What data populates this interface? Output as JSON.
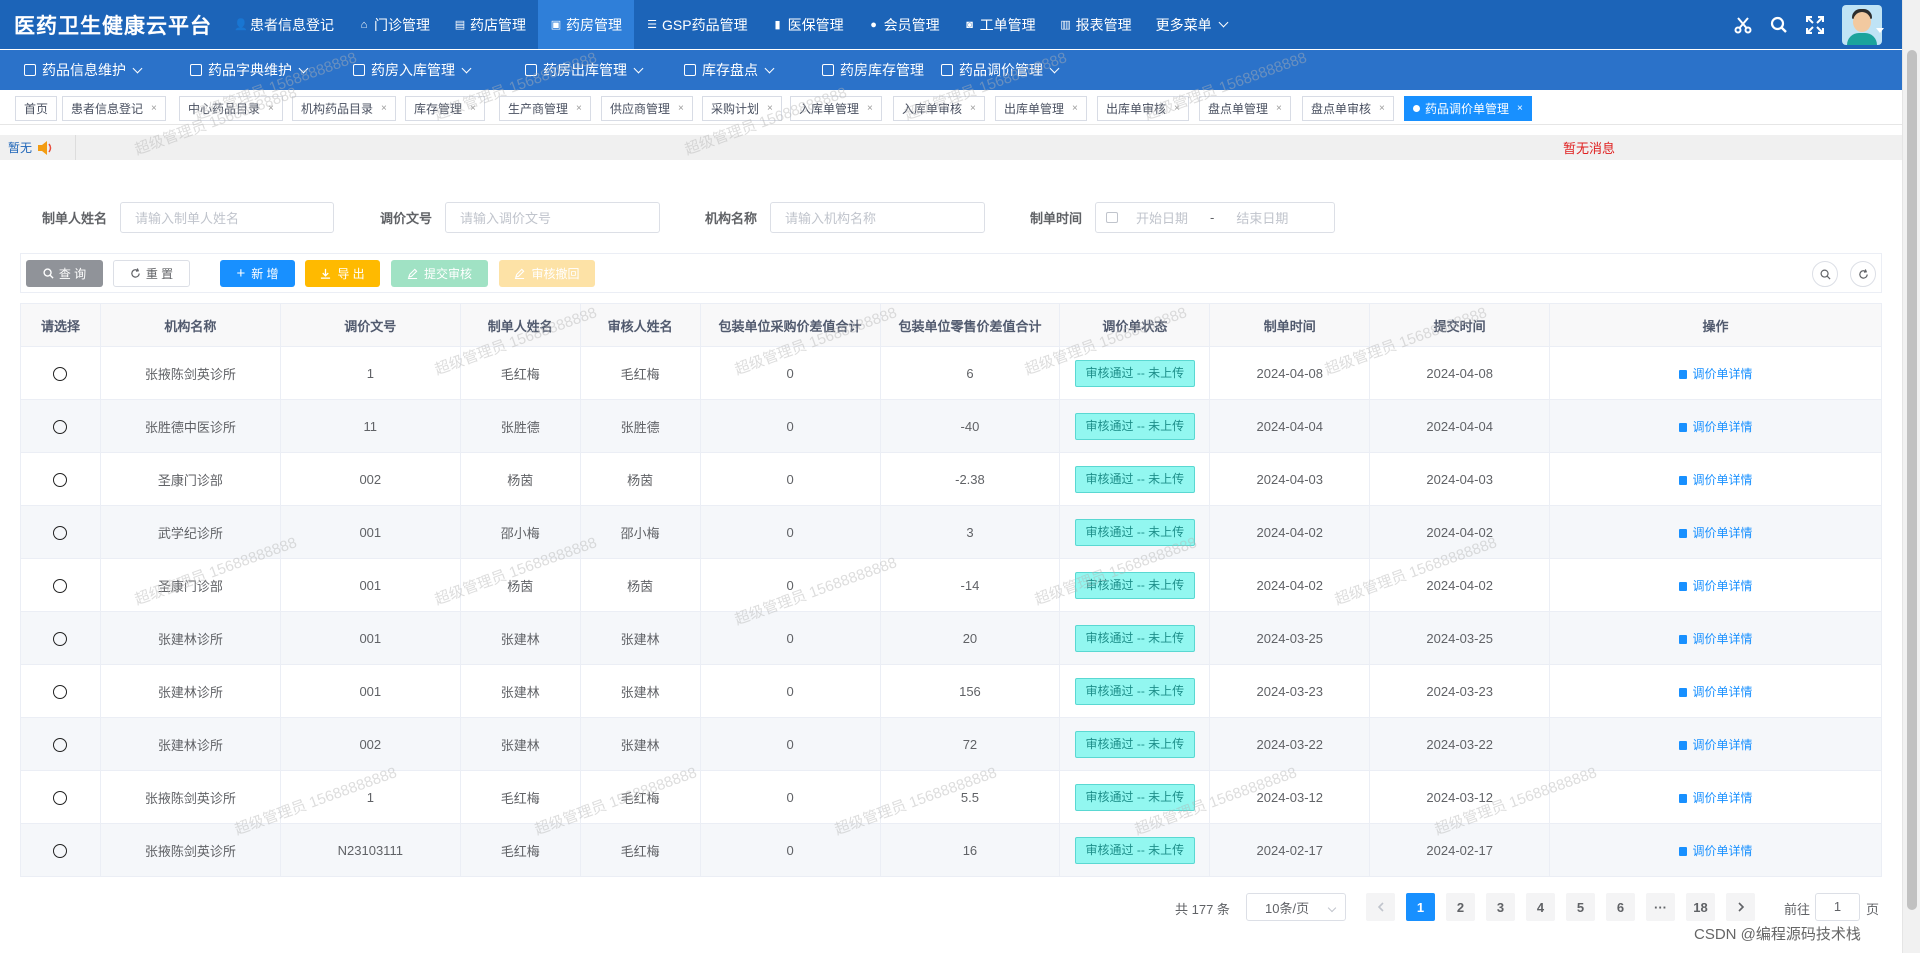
{
  "brand": "医药卫生健康云平台",
  "topnav": [
    {
      "label": "患者信息登记",
      "icon": "user-icon",
      "active": false
    },
    {
      "label": "门诊管理",
      "icon": "clinic-icon",
      "active": false
    },
    {
      "label": "药店管理",
      "icon": "store-icon",
      "active": false
    },
    {
      "label": "药房管理",
      "icon": "pharmacy-icon",
      "active": true
    },
    {
      "label": "GSP药品管理",
      "icon": "list-icon",
      "active": false
    },
    {
      "label": "医保管理",
      "icon": "book-icon",
      "active": false
    },
    {
      "label": "会员管理",
      "icon": "github-icon",
      "active": false
    },
    {
      "label": "工单管理",
      "icon": "ticket-icon",
      "active": false
    },
    {
      "label": "报表管理",
      "icon": "chart-icon",
      "active": false
    },
    {
      "label": "更多菜单",
      "icon": "",
      "active": false
    }
  ],
  "subnav": [
    "药品信息维护",
    "药品字典维护",
    "药房入库管理",
    "药房出库管理",
    "库存盘点",
    "药房库存管理",
    "药品调价管理"
  ],
  "tabs": [
    {
      "label": "首页",
      "closable": false,
      "active": false
    },
    {
      "label": "患者信息登记",
      "closable": true,
      "active": false
    },
    {
      "label": "中心药品目录",
      "closable": true,
      "active": false
    },
    {
      "label": "机构药品目录",
      "closable": true,
      "active": false
    },
    {
      "label": "库存管理",
      "closable": true,
      "active": false
    },
    {
      "label": "生产商管理",
      "closable": true,
      "active": false
    },
    {
      "label": "供应商管理",
      "closable": true,
      "active": false
    },
    {
      "label": "采购计划",
      "closable": true,
      "active": false
    },
    {
      "label": "入库单管理",
      "closable": true,
      "active": false
    },
    {
      "label": "入库单审核",
      "closable": true,
      "active": false
    },
    {
      "label": "出库单管理",
      "closable": true,
      "active": false
    },
    {
      "label": "出库单审核",
      "closable": true,
      "active": false
    },
    {
      "label": "盘点单管理",
      "closable": true,
      "active": false
    },
    {
      "label": "盘点单审核",
      "closable": true,
      "active": false
    },
    {
      "label": "药品调价单管理",
      "closable": true,
      "active": true
    }
  ],
  "notice": {
    "label": "暂无",
    "message": "暂无消息"
  },
  "filters": {
    "creator_label": "制单人姓名",
    "creator_placeholder": "请输入制单人姓名",
    "docno_label": "调价文号",
    "docno_placeholder": "请输入调价文号",
    "org_label": "机构名称",
    "org_placeholder": "请输入机构名称",
    "date_label": "制单时间",
    "start_placeholder": "开始日期",
    "date_sep": "-",
    "end_placeholder": "结束日期"
  },
  "toolbar": {
    "query": "查 询",
    "reset": "重 置",
    "add": "新 增",
    "export": "导 出",
    "submit": "提交审核",
    "withdraw": "审核撤回"
  },
  "table": {
    "headers": [
      "请选择",
      "机构名称",
      "调价文号",
      "制单人姓名",
      "审核人姓名",
      "包装单位采购价差值合计",
      "包装单位零售价差值合计",
      "调价单状态",
      "制单时间",
      "提交时间",
      "操作"
    ],
    "rows": [
      {
        "org": "张掖陈剑英诊所",
        "docno": "1",
        "creator": "毛红梅",
        "reviewer": "毛红梅",
        "purchase_diff": "0",
        "retail_diff": "6",
        "status": "审核通过 -- 未上传",
        "created": "2024-04-08",
        "submitted": "2024-04-08",
        "action": "调价单详情"
      },
      {
        "org": "张胜德中医诊所",
        "docno": "11",
        "creator": "张胜德",
        "reviewer": "张胜德",
        "purchase_diff": "0",
        "retail_diff": "-40",
        "status": "审核通过 -- 未上传",
        "created": "2024-04-04",
        "submitted": "2024-04-04",
        "action": "调价单详情"
      },
      {
        "org": "圣康门诊部",
        "docno": "002",
        "creator": "杨茵",
        "reviewer": "杨茵",
        "purchase_diff": "0",
        "retail_diff": "-2.38",
        "status": "审核通过 -- 未上传",
        "created": "2024-04-03",
        "submitted": "2024-04-03",
        "action": "调价单详情"
      },
      {
        "org": "武学纪诊所",
        "docno": "001",
        "creator": "邵小梅",
        "reviewer": "邵小梅",
        "purchase_diff": "0",
        "retail_diff": "3",
        "status": "审核通过 -- 未上传",
        "created": "2024-04-02",
        "submitted": "2024-04-02",
        "action": "调价单详情"
      },
      {
        "org": "圣康门诊部",
        "docno": "001",
        "creator": "杨茵",
        "reviewer": "杨茵",
        "purchase_diff": "0",
        "retail_diff": "-14",
        "status": "审核通过 -- 未上传",
        "created": "2024-04-02",
        "submitted": "2024-04-02",
        "action": "调价单详情"
      },
      {
        "org": "张建林诊所",
        "docno": "001",
        "creator": "张建林",
        "reviewer": "张建林",
        "purchase_diff": "0",
        "retail_diff": "20",
        "status": "审核通过 -- 未上传",
        "created": "2024-03-25",
        "submitted": "2024-03-25",
        "action": "调价单详情"
      },
      {
        "org": "张建林诊所",
        "docno": "001",
        "creator": "张建林",
        "reviewer": "张建林",
        "purchase_diff": "0",
        "retail_diff": "156",
        "status": "审核通过 -- 未上传",
        "created": "2024-03-23",
        "submitted": "2024-03-23",
        "action": "调价单详情"
      },
      {
        "org": "张建林诊所",
        "docno": "002",
        "creator": "张建林",
        "reviewer": "张建林",
        "purchase_diff": "0",
        "retail_diff": "72",
        "status": "审核通过 -- 未上传",
        "created": "2024-03-22",
        "submitted": "2024-03-22",
        "action": "调价单详情"
      },
      {
        "org": "张掖陈剑英诊所",
        "docno": "1",
        "creator": "毛红梅",
        "reviewer": "毛红梅",
        "purchase_diff": "0",
        "retail_diff": "5.5",
        "status": "审核通过 -- 未上传",
        "created": "2024-03-12",
        "submitted": "2024-03-12",
        "action": "调价单详情"
      },
      {
        "org": "张掖陈剑英诊所",
        "docno": "N23103111",
        "creator": "毛红梅",
        "reviewer": "毛红梅",
        "purchase_diff": "0",
        "retail_diff": "16",
        "status": "审核通过 -- 未上传",
        "created": "2024-02-17",
        "submitted": "2024-02-17",
        "action": "调价单详情"
      }
    ]
  },
  "pagination": {
    "total": "共 177 条",
    "page_size": "10条/页",
    "pages": [
      "1",
      "2",
      "3",
      "4",
      "5",
      "6",
      "···",
      "18"
    ],
    "current": "1",
    "goto_prefix": "前往",
    "goto_value": "1",
    "goto_suffix": "页"
  },
  "watermark_text": "超级管理员 15688888888",
  "footer_watermark": "CSDN @编程源码技术栈",
  "colors": {
    "topbar": "#1c64b8",
    "subbar": "#2b72c9",
    "primary": "#1890ff",
    "status_bg": "#92f7f0"
  }
}
